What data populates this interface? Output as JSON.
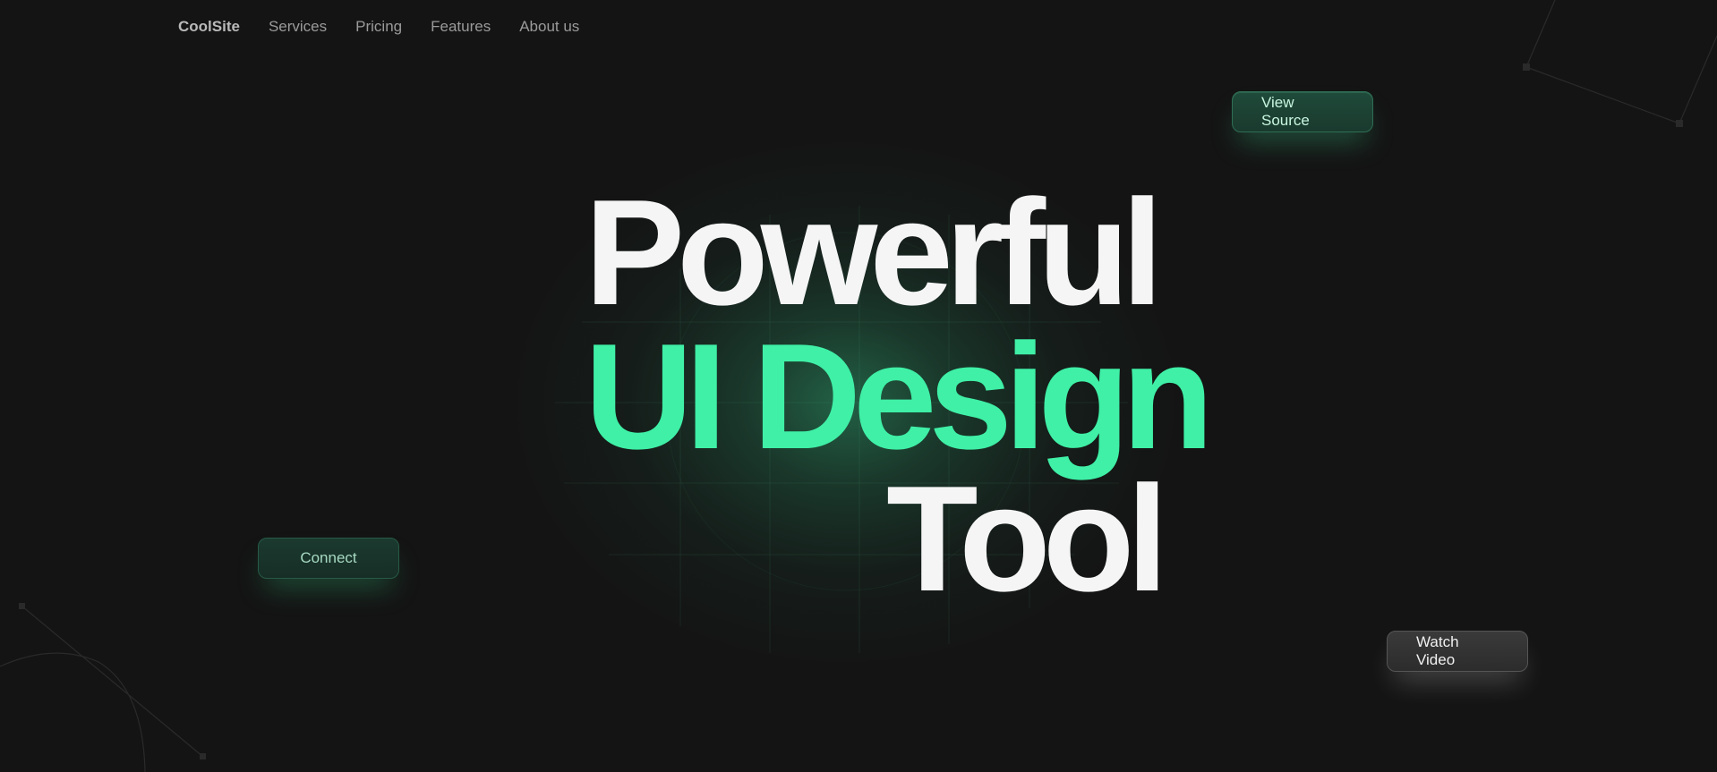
{
  "nav": {
    "brand": "CoolSite",
    "links": [
      "Services",
      "Pricing",
      "Features",
      "About us"
    ]
  },
  "hero": {
    "line1": "Powerful",
    "line2": "UI Design",
    "line3": "Tool"
  },
  "buttons": {
    "view_source": "View Source",
    "connect": "Connect",
    "watch_video": "Watch Video"
  },
  "colors": {
    "background": "#141414",
    "accent": "#3ff0a6",
    "headline": "#f5f5f5"
  }
}
